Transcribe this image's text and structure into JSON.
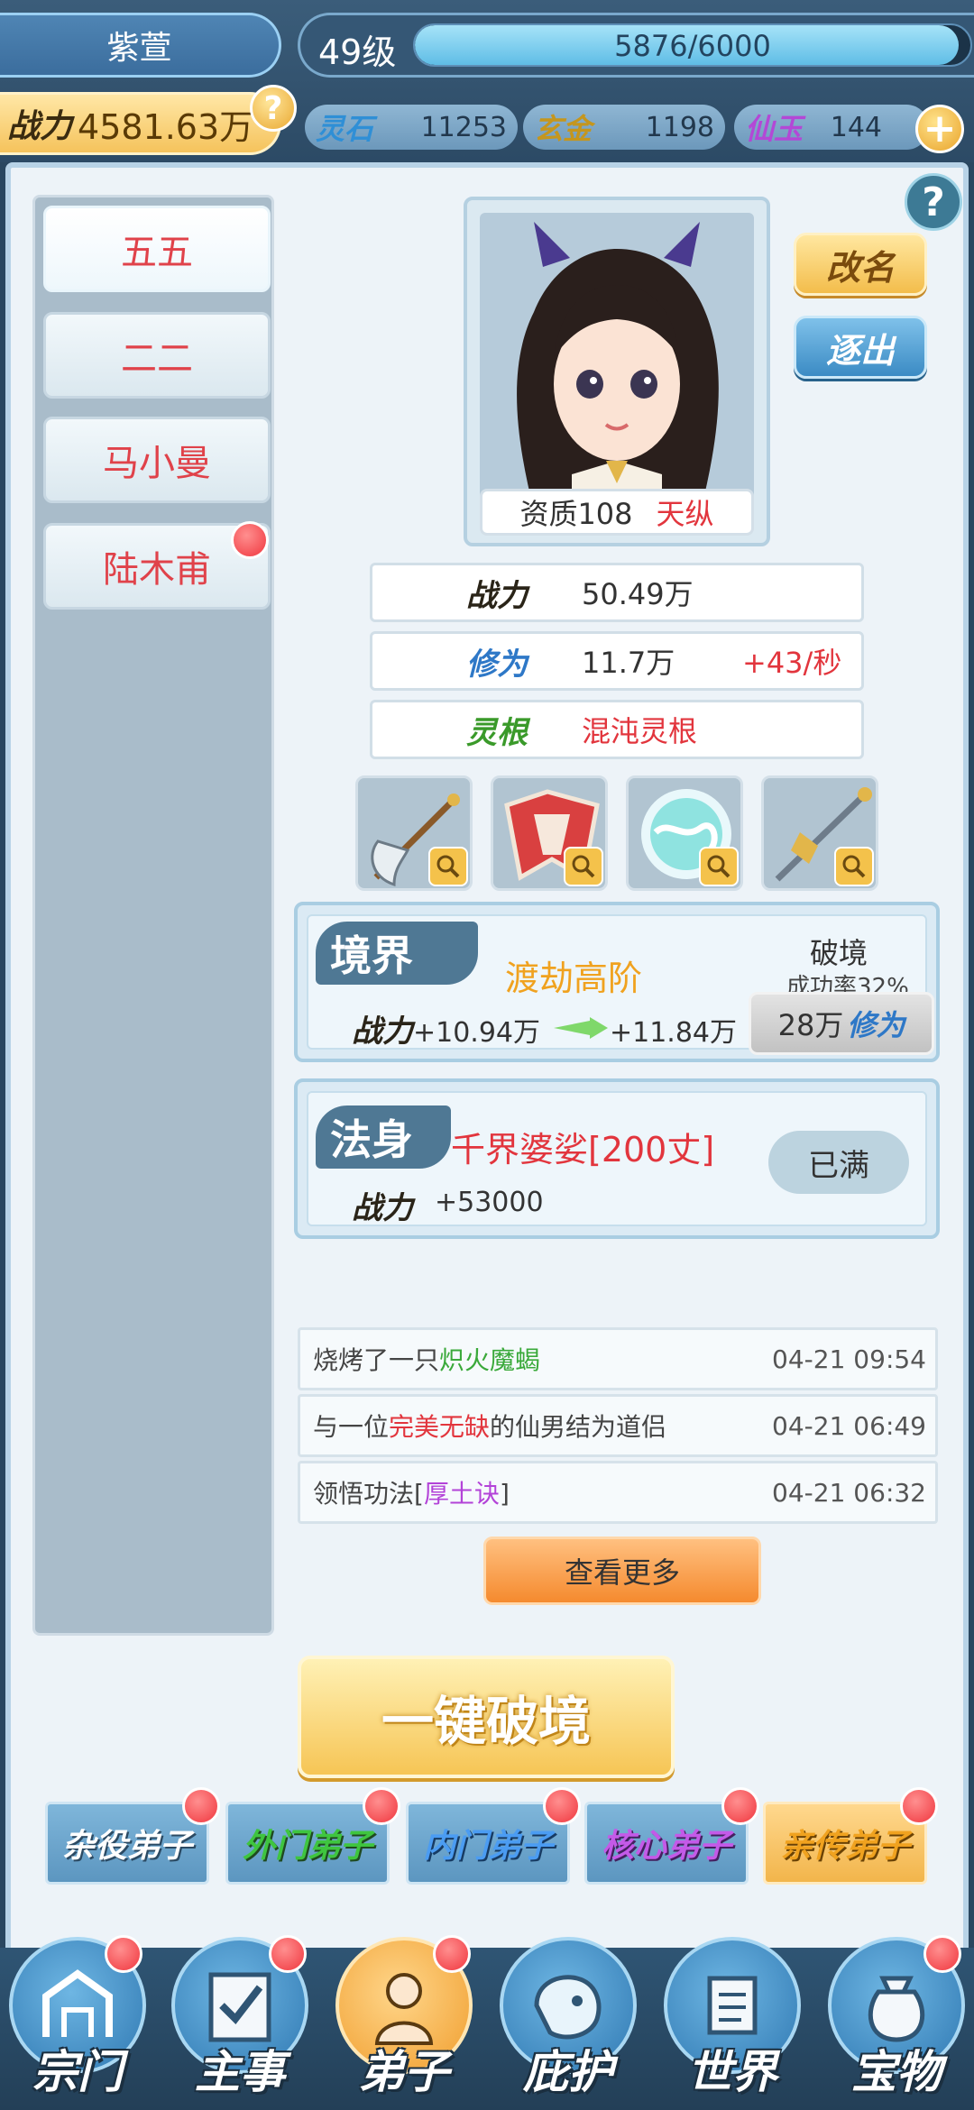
{
  "header": {
    "name": "紫萱",
    "level": "49级",
    "exp_text": "5876/6000",
    "exp_fraction": 0.979,
    "power_label": "战力",
    "power_value": "4581.63万",
    "help_icon": "question-coin-icon",
    "resources": [
      {
        "label": "灵石",
        "value": "11253",
        "color": "#2f8fd6"
      },
      {
        "label": "玄金",
        "value": "1198",
        "color": "#c5961d"
      },
      {
        "label": "仙玉",
        "value": "144",
        "color": "#b348d6"
      }
    ],
    "plus_icon": "plus-icon"
  },
  "disciples": [
    {
      "name": "五五",
      "active": true,
      "badge": false
    },
    {
      "name": "二二",
      "active": false,
      "badge": false
    },
    {
      "name": "马小曼",
      "active": false,
      "badge": false
    },
    {
      "name": "陆木甫",
      "active": false,
      "badge": true
    }
  ],
  "profile": {
    "aptitude_label": "资质108",
    "aptitude_grade": "天纵",
    "rename_label": "改名",
    "expel_label": "逐出"
  },
  "stats": {
    "power": {
      "label": "战力",
      "value": "50.49万"
    },
    "cultivation": {
      "label": "修为",
      "value": "11.7万",
      "rate": "+43/秒"
    },
    "root": {
      "label": "灵根",
      "value": "混沌灵根"
    }
  },
  "equipment": [
    {
      "name": "axe-icon"
    },
    {
      "name": "robe-icon"
    },
    {
      "name": "orb-icon"
    },
    {
      "name": "staff-icon"
    }
  ],
  "realm": {
    "title": "境界",
    "name": "渡劫高阶",
    "breakthrough_title": "破境",
    "success_rate": "成功率32%",
    "power_label": "战力",
    "power_current": "+10.94万",
    "power_next": "+11.84万",
    "cost": "28万",
    "cost_unit": "修为"
  },
  "dharma_body": {
    "title": "法身",
    "name": "千界婆娑[200丈]",
    "power_label": "战力",
    "power_value": "+53000",
    "status": "已满"
  },
  "logs": [
    {
      "prefix": "烧烤了一只",
      "highlight": "炽火魔蝎",
      "suffix": "",
      "hl_color": "green",
      "time": "04-21 09:54"
    },
    {
      "prefix": "与一位",
      "highlight": "完美无缺",
      "suffix": "的仙男结为道侣",
      "hl_color": "red",
      "time": "04-21 06:49"
    },
    {
      "prefix": "领悟功法[",
      "highlight": "厚土诀",
      "suffix": "]",
      "hl_color": "purple",
      "time": "04-21 06:32"
    }
  ],
  "more_label": "查看更多",
  "one_key_label": "一键破境",
  "tiers": [
    {
      "label": "杂役弟子",
      "color": "#ffffff"
    },
    {
      "label": "外门弟子",
      "color": "#3fc53f"
    },
    {
      "label": "内门弟子",
      "color": "#4b9cf2"
    },
    {
      "label": "核心弟子",
      "color": "#c45ae8"
    },
    {
      "label": "亲传弟子",
      "color": "#f0a21f"
    }
  ],
  "nav": [
    {
      "label": "宗门",
      "icon": "sect-gate-icon",
      "active": false
    },
    {
      "label": "主事",
      "icon": "checklist-icon",
      "active": false
    },
    {
      "label": "弟子",
      "icon": "disciple-icon",
      "active": true
    },
    {
      "label": "庇护",
      "icon": "shield-beast-icon",
      "active": false
    },
    {
      "label": "世界",
      "icon": "scroll-map-icon",
      "active": false
    },
    {
      "label": "宝物",
      "icon": "treasure-bag-icon",
      "active": false
    }
  ]
}
